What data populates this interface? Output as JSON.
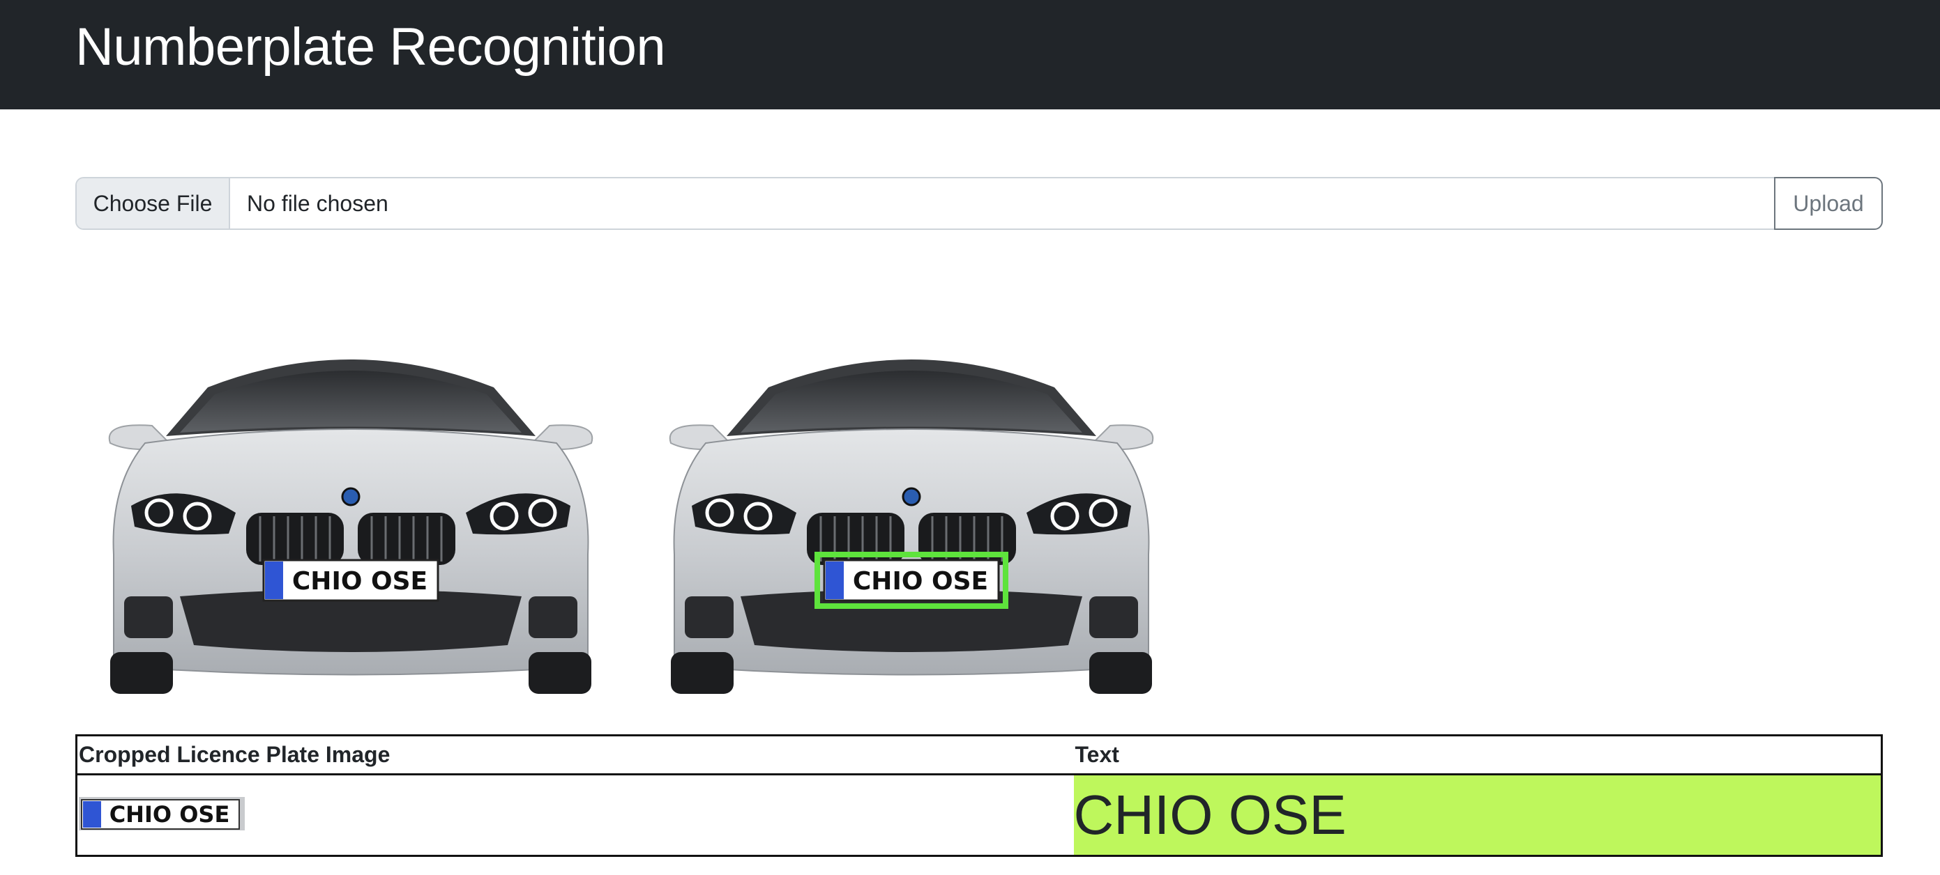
{
  "header": {
    "title": "Numberplate Recognition"
  },
  "upload": {
    "choose_label": "Choose File",
    "status_text": "No file chosen",
    "submit_label": "Upload"
  },
  "images": {
    "original": {
      "plate": "CHIO OSE"
    },
    "detected": {
      "plate": "CHIO OSE",
      "box_color": "#5ee33c"
    }
  },
  "table": {
    "headers": [
      "Cropped Licence Plate Image",
      "Text"
    ],
    "rows": [
      {
        "crop_plate": "CHIO OSE",
        "text": "CHIO OSE"
      }
    ],
    "highlight_color": "#bef75c"
  }
}
